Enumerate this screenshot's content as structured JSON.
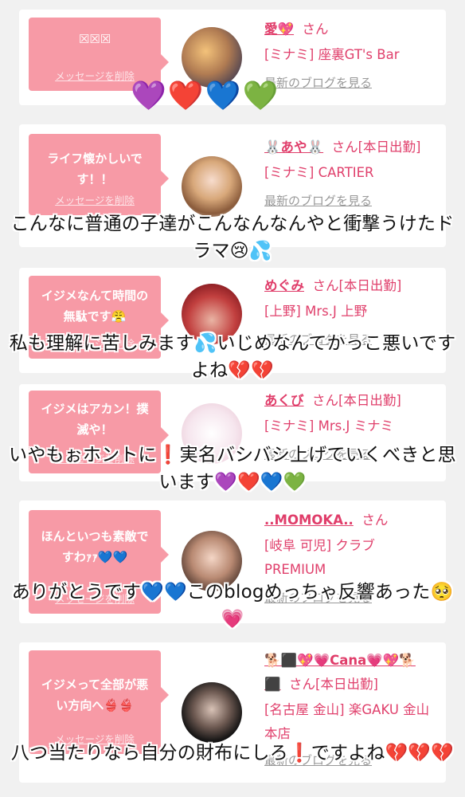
{
  "cards": [
    {
      "message": "☒☒☒",
      "delete_label": "メッセージを削除",
      "name": "愛💖",
      "san": "さん",
      "location": "[ミナミ] 座裏GT's Bar",
      "blog": "最新のブログを見る"
    },
    {
      "message": "ライフ懐かしいです！！",
      "delete_label": "メッセージを削除",
      "name": "🐰あや🐰",
      "san": "さん[本日出勤]",
      "location": "[ミナミ] CARTIER",
      "blog": "最新のブログを見る"
    },
    {
      "message": "イジメなんて時間の無駄です😤",
      "delete_label": "メッセージを削除",
      "name": "めぐみ",
      "san": "さん[本日出勤]",
      "location": "[上野] Mrs.J 上野",
      "blog": "最新のブログを見る"
    },
    {
      "message": "イジメはアカン！撲滅や！",
      "delete_label": "メッセージを削除",
      "name": "あくび",
      "san": "さん[本日出勤]",
      "location": "[ミナミ] Mrs.J ミナミ",
      "blog": "最新のブログを見る"
    },
    {
      "message": "ほんといつも素敵ですわｧｧ💙💙",
      "delete_label": "メッセージを削除",
      "name": "..MOMOKA..",
      "san": "さん",
      "location": "[岐阜 可児] クラブ PREMIUM",
      "blog": "最新のブログを見る"
    },
    {
      "message": "イジメって全部が悪い方向へ👙👙",
      "delete_label": "メッセージを削除",
      "name": "🐕⬛💖💗Cana💗💖🐕⬛",
      "san": "さん[本日出勤]",
      "location": "[名古屋 金山] 楽GAKU 金山本店",
      "blog": "最新のブログを見る"
    }
  ],
  "overlay": {
    "hearts_top": "💜❤️💙💚",
    "captions": [
      "こんなに普通の子達がこんなんなんやと衝撃うけたドラマ😢💦",
      "私も理解に苦しみます💦いじめなんてかっこ悪いですよね💔💔",
      "いやもぉホントに❗実名バシバシ上げていくべきと思います💜❤️💙💚",
      "ありがとうです💙💙このblogめっちゃ反響あった🥺💗",
      "八つ当たりなら自分の財布にしろ❗ですよね💔💔💔"
    ]
  },
  "colors": {
    "bubble": "#f79aa6",
    "name": "#e03d6a",
    "background": "#f1f1f1"
  }
}
